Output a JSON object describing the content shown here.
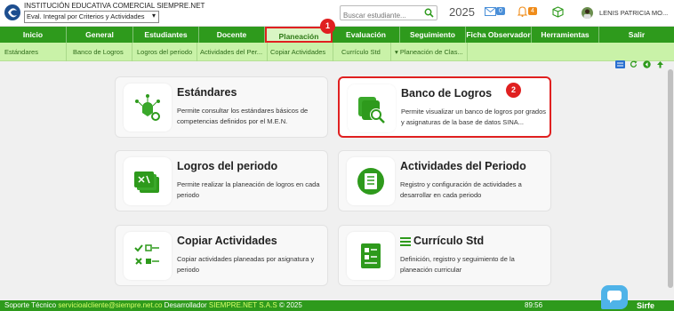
{
  "header": {
    "institution": "INSTITUCIÓN EDUCATIVA COMERCIAL SIEMPRE.NET",
    "mode_selected": "Eval. Integral por Criterios y Actividades",
    "search_placeholder": "Buscar estudiante...",
    "year": "2025",
    "mail_count": "0",
    "bell_count": "4",
    "user_name": "LENIS PATRICIA MO...",
    "accent_color": "#2e9a1c"
  },
  "nav": {
    "items": [
      "Inicio",
      "General",
      "Estudiantes",
      "Docente",
      "Planeación",
      "Evaluación",
      "Seguimiento",
      "Ficha Observador",
      "Herramientas",
      "Salir"
    ],
    "active": "Planeación"
  },
  "subnav": {
    "items": [
      "Estándares",
      "Banco de Logros",
      "Logros del periodo",
      "Actividades del Per...",
      "Copiar Actividades",
      "Currículo Std",
      "▾ Planeación de Clas..."
    ]
  },
  "cards": [
    {
      "title": "Estándares",
      "desc": "Permite consultar los estándares básicos de competencias definidos por el M.E.N.",
      "icon": "standards-icon"
    },
    {
      "title": "Banco de Logros",
      "desc": "Permite visualizar un banco de logros por grados y asignaturas de la base de datos SINA...",
      "icon": "achievement-bank-icon"
    },
    {
      "title": "Logros del periodo",
      "desc": "Permite realizar la planeación de logros en cada periodo",
      "icon": "period-achievements-icon"
    },
    {
      "title": "Actividades del Periodo",
      "desc": "Registro y configuración de actividades a desarrollar en cada periodo",
      "icon": "activities-list-icon"
    },
    {
      "title": "Copiar Actividades",
      "desc": "Copiar actividades planeadas por asignatura y periodo",
      "icon": "copy-activities-icon"
    },
    {
      "title": "Currículo Std",
      "desc": "Definición, registro y seguimiento de la planeación curricular",
      "icon": "curriculum-icon"
    }
  ],
  "markers": [
    "1",
    "2"
  ],
  "footer": {
    "support_label": "Soporte Técnico",
    "support_email": "servicioalcliente@siempre.net.co",
    "dev_label": "Desarrollador",
    "dev_name": "SIEMPRE.NET S.A.S",
    "copyright": "© 2025",
    "timer": "89:56",
    "brand": "Sirfe"
  }
}
